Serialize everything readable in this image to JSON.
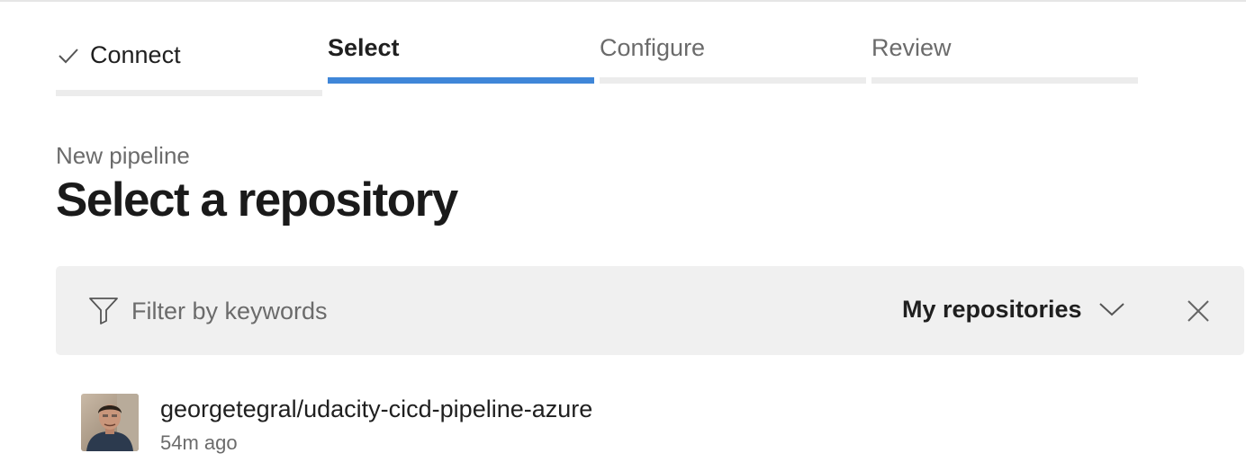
{
  "wizard": {
    "steps": [
      {
        "label": "Connect",
        "state": "completed"
      },
      {
        "label": "Select",
        "state": "active"
      },
      {
        "label": "Configure",
        "state": "pending"
      },
      {
        "label": "Review",
        "state": "pending"
      }
    ],
    "accent_color": "#3f86d8"
  },
  "header": {
    "subtitle": "New pipeline",
    "title": "Select a repository"
  },
  "filter": {
    "placeholder": "Filter by keywords",
    "value": "",
    "scope_selected": "My repositories",
    "icons": [
      "filter-icon",
      "chevron-down-icon",
      "close-icon"
    ]
  },
  "repositories": [
    {
      "name": "georgetegral/udacity-cicd-pipeline-azure",
      "updated": "54m ago"
    }
  ]
}
